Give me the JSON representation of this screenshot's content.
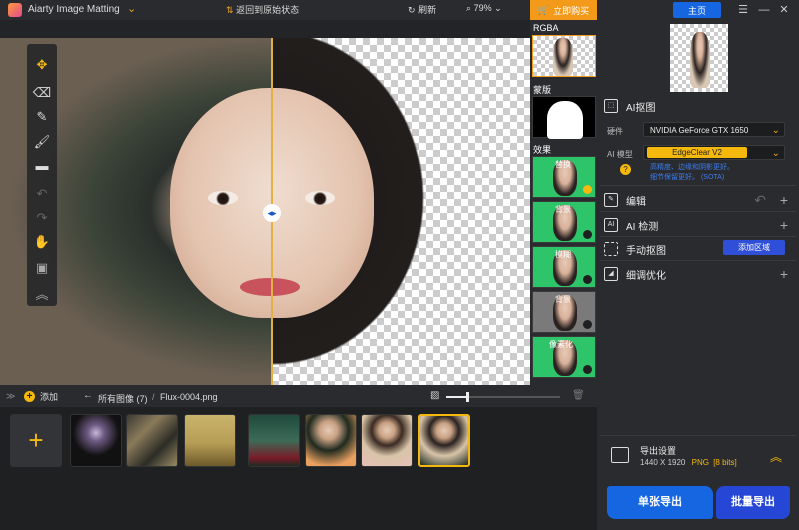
{
  "title_bar": {
    "app_title": "Aiarty Image Matting",
    "buy_button": "立即购买",
    "home_button": "主页"
  },
  "toolbar": {
    "reset_label": "返回到原始状态",
    "refresh_label": "刷新",
    "zoom_value": "79%"
  },
  "preview_strip": {
    "rgba_label": "RGBA",
    "mask_label": "蒙版",
    "effects_label": "效果",
    "effects": [
      "替换",
      "背景",
      "模糊",
      "背景",
      "像素化"
    ]
  },
  "right_panel": {
    "ai_matting": {
      "title": "AI抠图",
      "hardware_label": "硬件",
      "hardware_value": "NVIDIA GeForce GTX 1650",
      "model_label": "AI 模型",
      "model_value": "EdgeClear  V2",
      "model_note_line1": "高精度、边缘和阴影更好。",
      "model_note_line2": "细节保留更好。   (SOTA)"
    },
    "sections": {
      "edit": "编辑",
      "ai_detect": "AI 检测",
      "manual_matting": "手动抠图",
      "add_region": "添加区域",
      "fine_tune": "细调优化"
    },
    "export": {
      "title": "导出设置",
      "dimensions": "1440 X 1920",
      "format": "PNG",
      "bits": "[8 bits]",
      "single_export": "单张导出",
      "batch_export": "批量导出"
    }
  },
  "bottom_bar": {
    "add_label": "添加",
    "all_images": "所有图像 (7)",
    "separator": "/",
    "current_file": "Flux-0004.png",
    "zoom_slider_fraction": 0.2
  },
  "gallery": {
    "count": 7,
    "selected_index": 6
  }
}
